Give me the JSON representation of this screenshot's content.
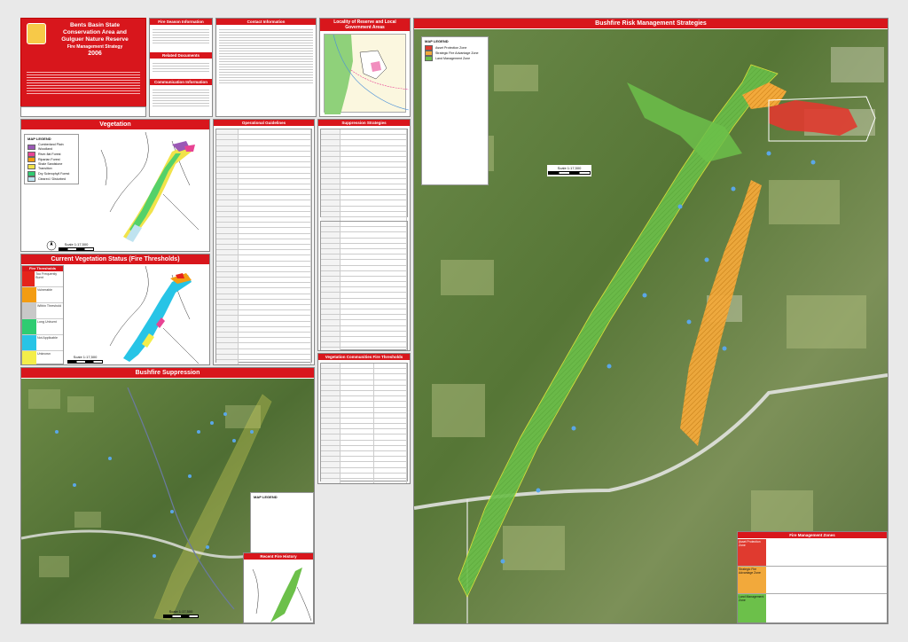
{
  "title": {
    "line1": "Bents Basin State",
    "line2": "Conservation Area and",
    "line3": "Gulguer Nature Reserve",
    "line4": "Fire Management Strategy",
    "year": "2006"
  },
  "info_headers": {
    "fire_season": "Fire Season Information",
    "related_docs": "Related Documents",
    "communication": "Communication Information",
    "contact": "Contact Information",
    "locality": "Locality of Reserve and Local Government Areas"
  },
  "panels": {
    "vegetation": "Vegetation",
    "current_status": "Current Vegetation Status (Fire Thresholds)",
    "suppression": "Bushfire Suppression",
    "recent_fire": "Recent Fire History",
    "operational": "Operational Guidelines",
    "suppression_strategies": "Suppression Strategies",
    "veg_thresholds": "Vegetation Communities Fire Thresholds",
    "risk_strategies": "Bushfire Risk Management Strategies",
    "fmz": "Fire Management Zones"
  },
  "legends": {
    "map_legend": "MAP LEGEND",
    "veg_items": [
      {
        "label": "Cumberland Plain Woodland",
        "color": "#9b59b6"
      },
      {
        "label": "River-flat Forest",
        "color": "#e84393"
      },
      {
        "label": "Riparian Forest",
        "color": "#f39c12"
      },
      {
        "label": "Shale Sandstone Transition",
        "color": "#f1e34a"
      },
      {
        "label": "Dry Sclerophyll Forest",
        "color": "#2ecc71"
      },
      {
        "label": "Cleared / Disturbed",
        "color": "#bfe3f0"
      }
    ],
    "fire_thresholds": "Fire Thresholds",
    "fire_items": [
      {
        "label": "Too Frequently Burnt",
        "color": "#e5231b"
      },
      {
        "label": "Vulnerable",
        "color": "#f39c12"
      },
      {
        "label": "Within Threshold",
        "color": "#c8c8c8"
      },
      {
        "label": "Long Unburnt",
        "color": "#2ecc71"
      },
      {
        "label": "Not Applicable",
        "color": "#27c4e6"
      },
      {
        "label": "Unknown",
        "color": "#f4ee4a"
      }
    ],
    "risk_items": [
      {
        "label": "Asset Protection Zone",
        "color": "#e03a2f"
      },
      {
        "label": "Strategic Fire Advantage Zone",
        "color": "#f2a93b"
      },
      {
        "label": "Land Management Zone",
        "color": "#6cc04a"
      }
    ]
  },
  "scale_text": "Scale 1:17,500",
  "fmz_rows": [
    {
      "zone": "Asset Protection Zone",
      "color": "#e03a2f"
    },
    {
      "zone": "Strategic Fire Advantage Zone",
      "color": "#f2a93b"
    },
    {
      "zone": "Land Management Zone",
      "color": "#6cc04a"
    }
  ],
  "colors": {
    "accent": "#d8161c",
    "apz": "#e03a2f",
    "sfaz": "#f2a93b",
    "lmz": "#6cc04a",
    "satellite": "#5f7a3c"
  }
}
